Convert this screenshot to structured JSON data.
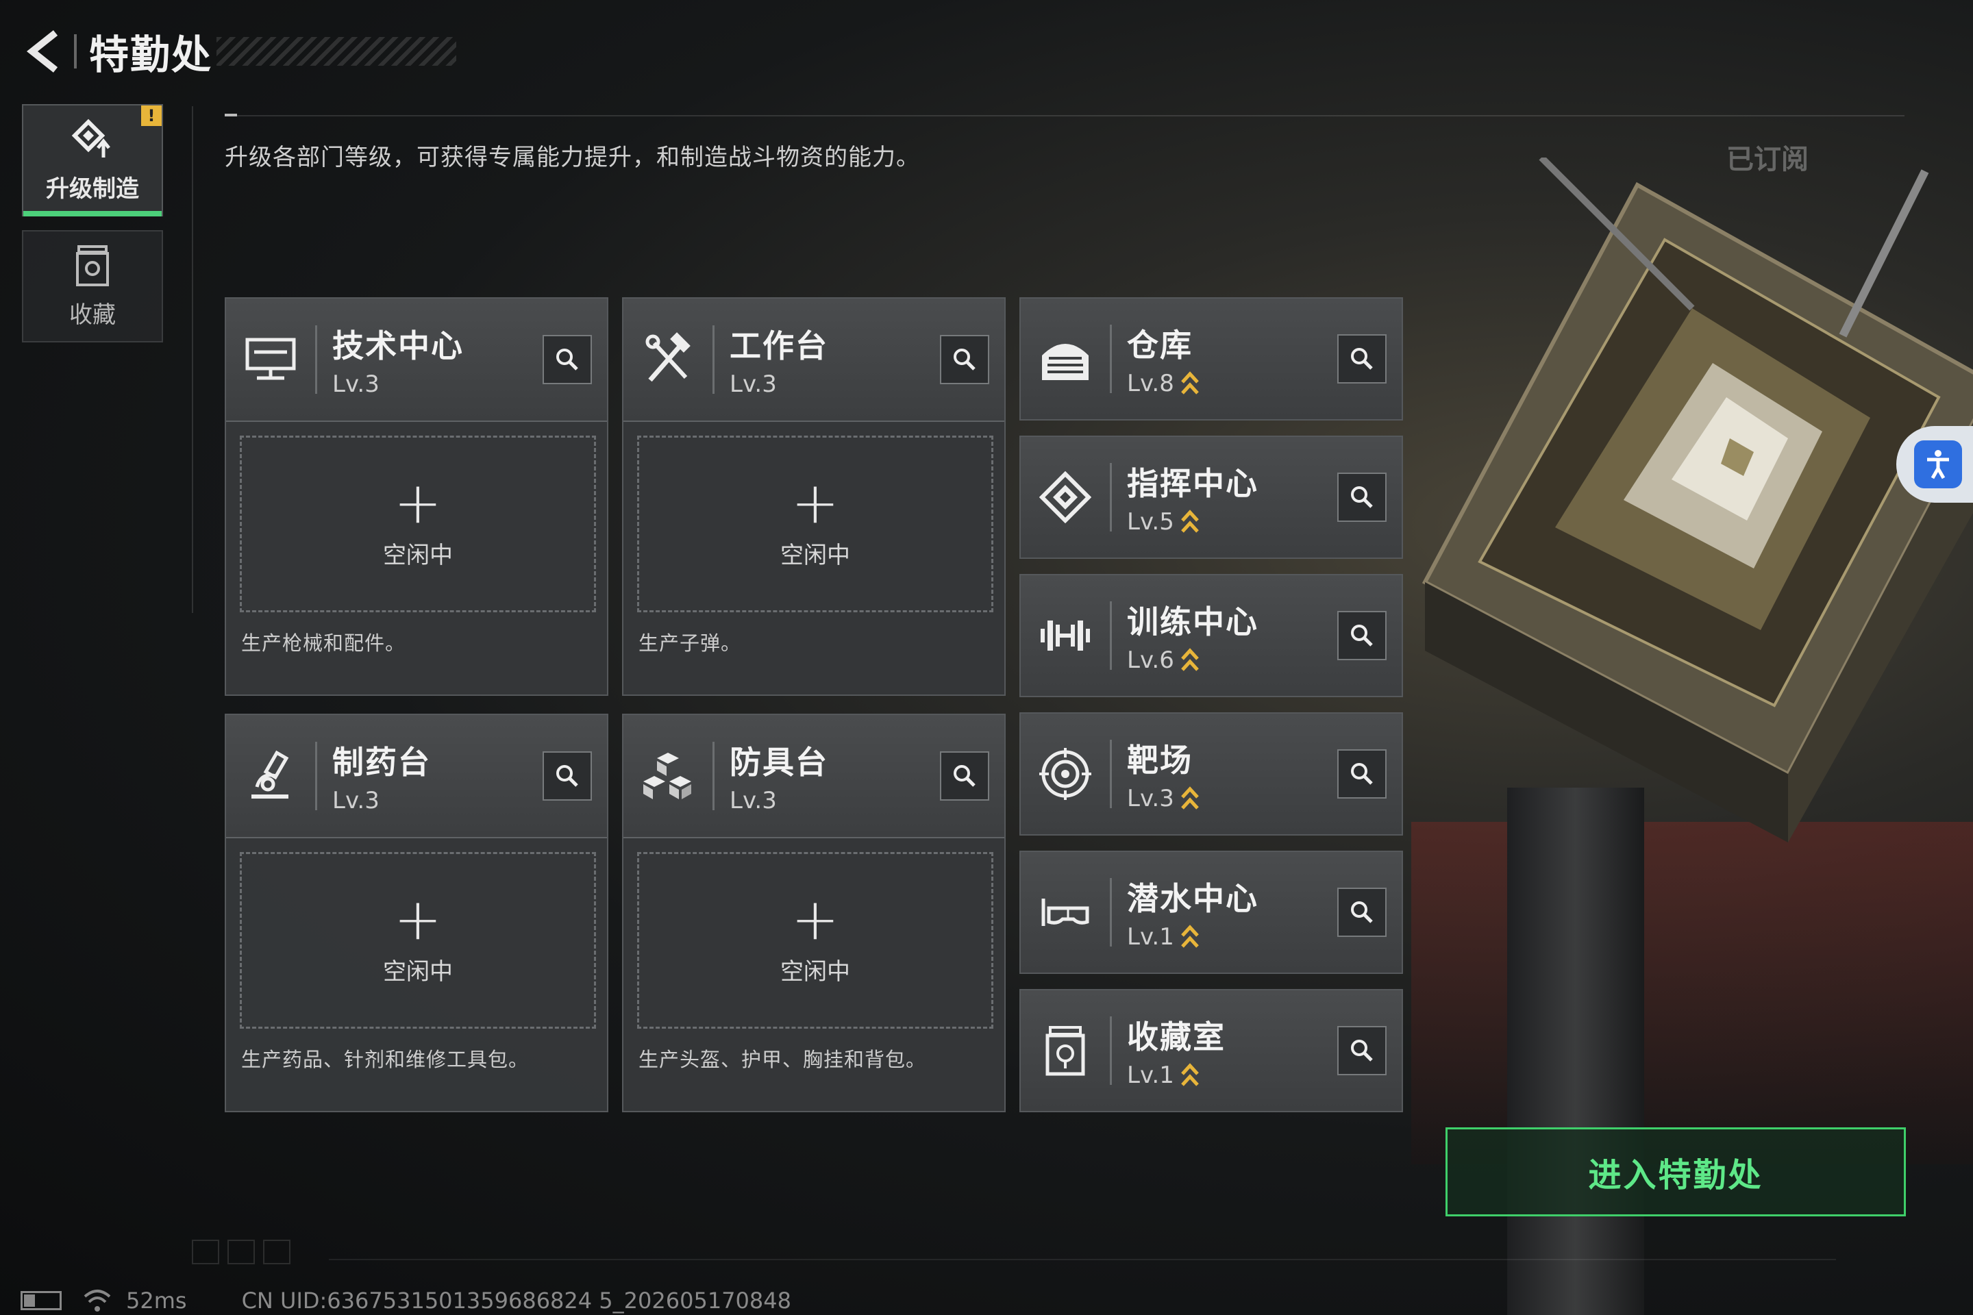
{
  "header": {
    "title": "特勤处"
  },
  "sidebar": {
    "items": [
      {
        "label": "升级制造",
        "badge": "!"
      },
      {
        "label": "收藏"
      }
    ]
  },
  "description": "升级各部门等级，可获得专属能力提升，和制造战斗物资的能力。",
  "subscribed_label": "已订阅",
  "production": [
    {
      "name": "技术中心",
      "level": "Lv.3",
      "slot_plus": "+",
      "slot_status": "空闲中",
      "desc": "生产枪械和配件。"
    },
    {
      "name": "工作台",
      "level": "Lv.3",
      "slot_plus": "+",
      "slot_status": "空闲中",
      "desc": "生产子弹。"
    },
    {
      "name": "制药台",
      "level": "Lv.3",
      "slot_plus": "+",
      "slot_status": "空闲中",
      "desc": "生产药品、针剂和维修工具包。"
    },
    {
      "name": "防具台",
      "level": "Lv.3",
      "slot_plus": "+",
      "slot_status": "空闲中",
      "desc": "生产头盔、护甲、胸挂和背包。"
    }
  ],
  "facilities": [
    {
      "name": "仓库",
      "level": "Lv.8"
    },
    {
      "name": "指挥中心",
      "level": "Lv.5"
    },
    {
      "name": "训练中心",
      "level": "Lv.6"
    },
    {
      "name": "靶场",
      "level": "Lv.3"
    },
    {
      "name": "潜水中心",
      "level": "Lv.1"
    },
    {
      "name": "收藏室",
      "level": "Lv.1"
    }
  ],
  "enter_button": "进入特勤处",
  "status_bar": {
    "ping": "52ms",
    "uid": "CN UID:6367531501359686824 5_202605170848"
  },
  "colors": {
    "accent_green": "#4cd07a",
    "upgrade_arrow": "#e8b53a",
    "warning": "#e8b53a"
  }
}
